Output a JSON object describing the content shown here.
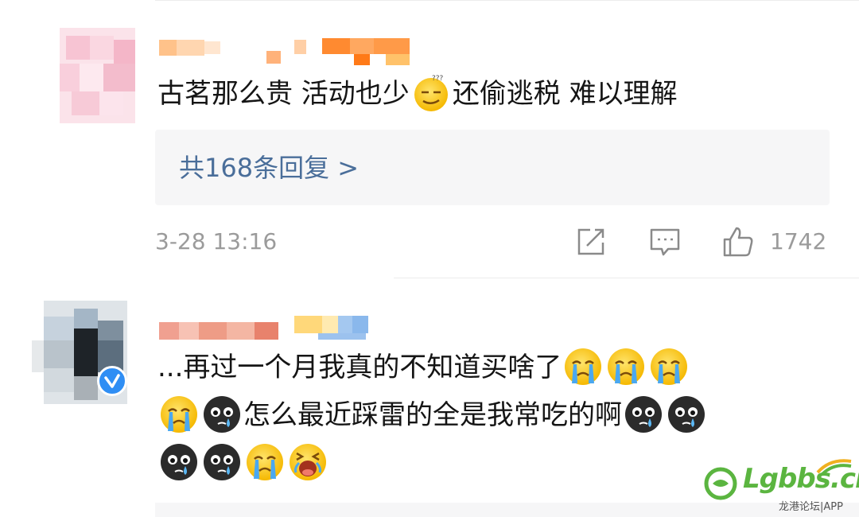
{
  "comments": [
    {
      "text_before_emoji": "古茗那么贵 活动也少",
      "emoji": "confused-smile-emoji",
      "text_after_emoji": "还偷逃税 难以理解",
      "replies_label": "共168条回复 >",
      "date": "3-28 13:16",
      "like_count": "1742"
    },
    {
      "line1_text": "...再过一个月我真的不知道买啥了",
      "line1_emojis": [
        "crying-emoji",
        "crying-emoji",
        "crying-emoji"
      ],
      "line2_leading_emojis": [
        "crying-emoji",
        "tearful-black-face-emoji"
      ],
      "line2_text": "怎么最近踩雷的全是我常吃的啊",
      "line2_trailing_emojis": [
        "tearful-black-face-emoji",
        "tearful-black-face-emoji"
      ],
      "line3_emojis": [
        "tearful-black-face-emoji",
        "tearful-black-face-emoji",
        "crying-emoji",
        "wailing-emoji"
      ],
      "verified": true
    }
  ],
  "watermark": {
    "brand": "Lgbbs.cn",
    "sub": "龙港论坛|APP"
  },
  "colors": {
    "link": "#4a6e9a",
    "meta": "#9b9b9b",
    "verified": "#2f8ef4",
    "watermark_green": "#5bb540"
  }
}
